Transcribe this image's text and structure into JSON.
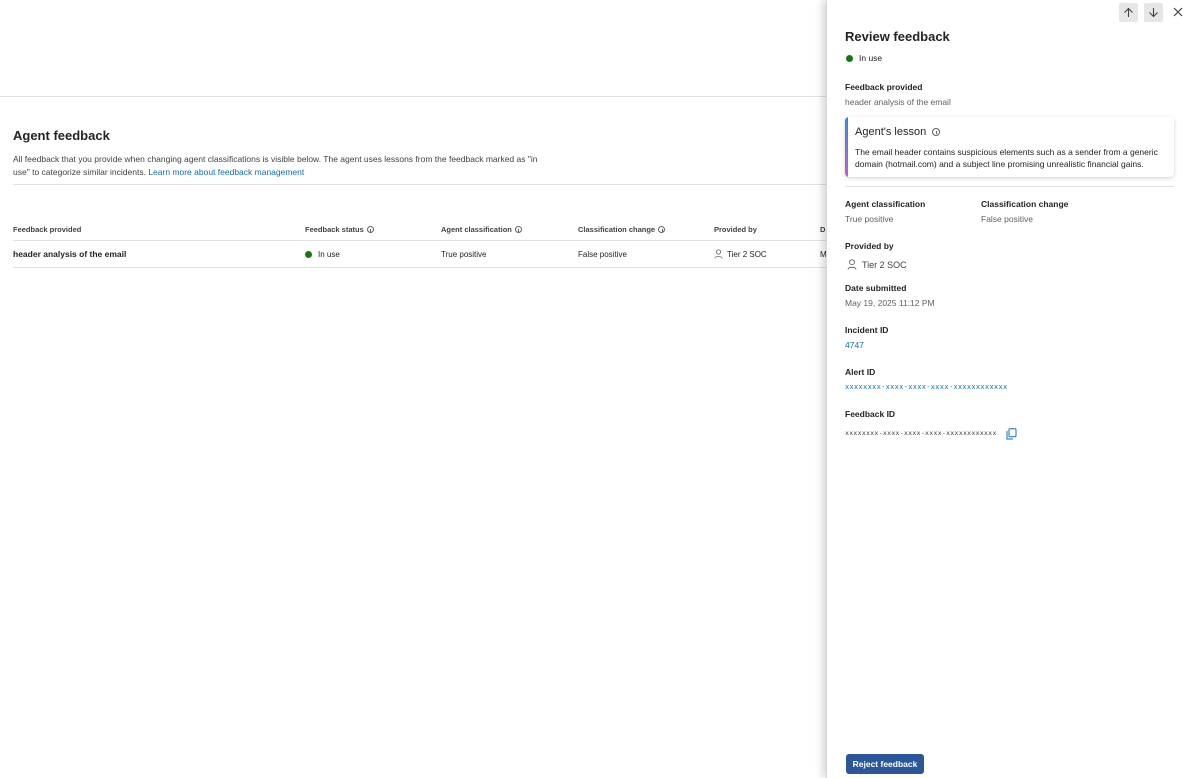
{
  "page": {
    "title": "Agent feedback",
    "description_prefix": "All feedback that you provide when changing agent classifications is visible below. The agent uses lessons from the feedback marked as \"in use\" to categorize similar incidents. ",
    "learn_more_link": "Learn more about feedback management"
  },
  "table": {
    "columns": [
      "Feedback provided",
      "Feedback status",
      "Agent classification",
      "Classification change",
      "Provided by",
      "D"
    ],
    "rows": [
      {
        "feedback": "header analysis of the email",
        "status": "In use",
        "agent_classification": "True positive",
        "classification_change": "False positive",
        "provided_by": "Tier 2 SOC",
        "date_fragment": "M"
      }
    ]
  },
  "panel": {
    "title": "Review feedback",
    "status": "In use",
    "feedback_provided_label": "Feedback provided",
    "feedback_provided_value": "header analysis of the email",
    "lesson_title": "Agent's lesson",
    "lesson_text": "The email header contains suspicious elements such as a sender from a generic domain (hotmail.com) and a subject line promising unrealistic financial gains.",
    "agent_classification_label": "Agent classification",
    "agent_classification_value": "True positive",
    "classification_change_label": "Classification change",
    "classification_change_value": "False positive",
    "provided_by_label": "Provided by",
    "provided_by_value": "Tier 2 SOC",
    "date_submitted_label": "Date submitted",
    "date_submitted_value": "May 19, 2025 11:12 PM",
    "incident_id_label": "Incident ID",
    "incident_id_value": "4747",
    "alert_id_label": "Alert ID",
    "alert_id_value": "xxxxxxxx-xxxx-xxxx-xxxx-xxxxxxxxxxxx",
    "feedback_id_label": "Feedback ID",
    "feedback_id_value": "xxxxxxxx-xxxx-xxxx-xxxx-xxxxxxxxxxxx",
    "reject_button": "Reject feedback"
  },
  "colors": {
    "status_green": "#107c10",
    "link_blue": "#0f6cbd",
    "primary_button": "#2b579a"
  },
  "icons": [
    "info-icon",
    "person-icon",
    "arrow-up-icon",
    "arrow-down-icon",
    "close-icon",
    "copy-icon"
  ]
}
